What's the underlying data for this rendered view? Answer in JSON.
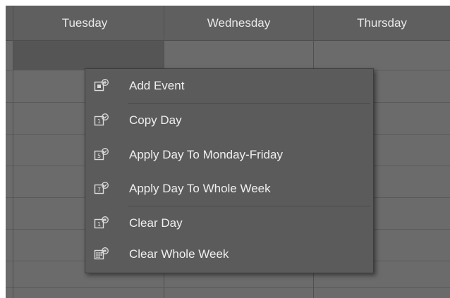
{
  "calendar": {
    "days": [
      {
        "label": "Tuesday"
      },
      {
        "label": "Wednesday"
      },
      {
        "label": "Thursday"
      }
    ]
  },
  "context_menu": {
    "items": [
      {
        "label": "Add Event",
        "icon": "add-event-icon"
      },
      {
        "label": "Copy Day",
        "icon": "copy-day-icon"
      },
      {
        "label": "Apply Day To Monday-Friday",
        "icon": "apply-weekdays-icon"
      },
      {
        "label": "Apply Day To Whole Week",
        "icon": "apply-week-icon"
      },
      {
        "label": "Clear Day",
        "icon": "clear-day-icon"
      },
      {
        "label": "Clear Whole Week",
        "icon": "clear-week-icon"
      }
    ],
    "icon_numbers": {
      "copy_day": "1",
      "apply_weekdays": "5",
      "apply_week": "7",
      "clear_day": "1"
    }
  },
  "colors": {
    "grid_background": "#6b6b6b",
    "header_background": "#5f5f5f",
    "menu_background": "#5b5b5b",
    "text": "#efefef"
  }
}
